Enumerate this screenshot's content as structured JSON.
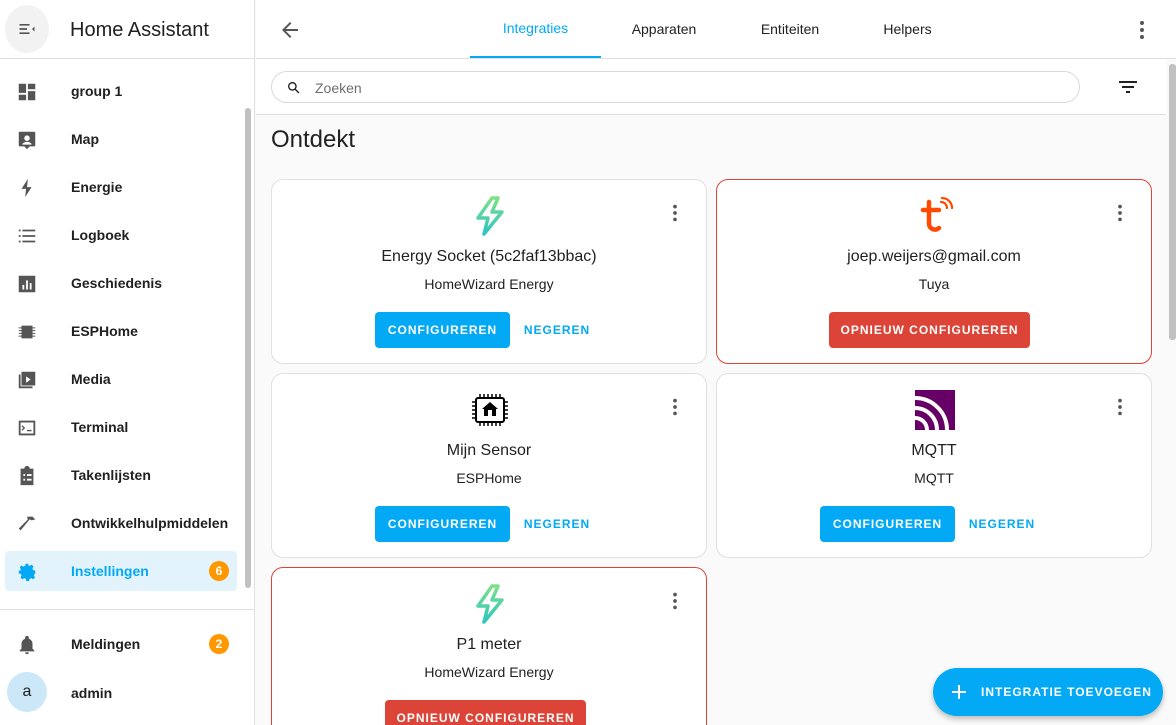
{
  "app": {
    "title": "Home Assistant"
  },
  "sidebar": {
    "items": [
      {
        "label": "group 1",
        "icon": "dashboard-icon"
      },
      {
        "label": "Map",
        "icon": "map-icon"
      },
      {
        "label": "Energie",
        "icon": "lightning-icon"
      },
      {
        "label": "Logboek",
        "icon": "list-icon"
      },
      {
        "label": "Geschiedenis",
        "icon": "chart-icon"
      },
      {
        "label": "ESPHome",
        "icon": "chip-icon"
      },
      {
        "label": "Media",
        "icon": "media-icon"
      },
      {
        "label": "Terminal",
        "icon": "terminal-icon"
      },
      {
        "label": "Takenlijsten",
        "icon": "clipboard-icon"
      },
      {
        "label": "Ontwikkelhulpmiddelen",
        "icon": "hammer-icon"
      },
      {
        "label": "Instellingen",
        "icon": "gear-icon",
        "badge": "6",
        "active": true
      }
    ],
    "notifications": {
      "label": "Meldingen",
      "badge": "2"
    },
    "user": {
      "label": "admin",
      "initial": "a"
    }
  },
  "tabs": [
    "Integraties",
    "Apparaten",
    "Entiteiten",
    "Helpers"
  ],
  "active_tab": "Integraties",
  "search": {
    "placeholder": "Zoeken",
    "value": ""
  },
  "section": {
    "title": "Ontdekt"
  },
  "cards": [
    {
      "title": "Energy Socket (5c2faf13bbac)",
      "subtitle": "HomeWizard Energy",
      "primary": "CONFIGUREREN",
      "secondary": "NEGEREN",
      "logo": "homewizard-logo"
    },
    {
      "title": "joep.weijers@gmail.com",
      "subtitle": "Tuya",
      "danger": "OPNIEUW CONFIGUREREN",
      "logo": "tuya-logo"
    },
    {
      "title": "Mijn Sensor",
      "subtitle": "ESPHome",
      "primary": "CONFIGUREREN",
      "secondary": "NEGEREN",
      "logo": "esphome-logo"
    },
    {
      "title": "MQTT",
      "subtitle": "MQTT",
      "primary": "CONFIGUREREN",
      "secondary": "NEGEREN",
      "logo": "mqtt-logo"
    },
    {
      "title": "P1 meter",
      "subtitle": "HomeWizard Energy",
      "danger": "OPNIEUW CONFIGUREREN",
      "logo": "homewizard-logo"
    }
  ],
  "fab": {
    "label": "INTEGRATIE TOEVOEGEN"
  },
  "colors": {
    "accent": "#03a9f4",
    "error": "#db4437",
    "badge": "#ff9800"
  }
}
